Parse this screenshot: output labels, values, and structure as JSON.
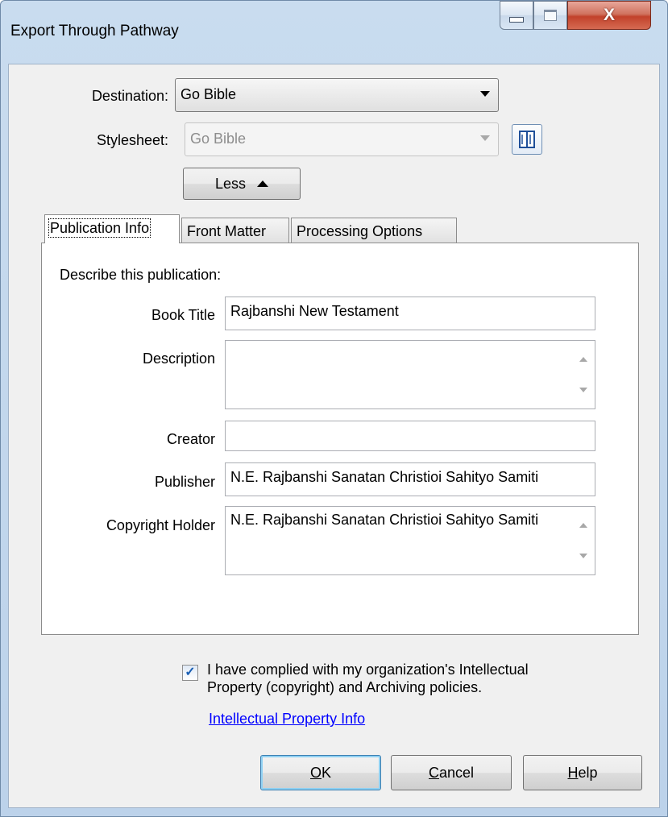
{
  "window": {
    "title": "Export Through Pathway",
    "controls": {
      "minimize_icon": "minimize-icon",
      "maximize_icon": "maximize-icon",
      "close_glyph": "X"
    }
  },
  "destination": {
    "label": "Destination:",
    "value": "Go Bible"
  },
  "stylesheet": {
    "label": "Stylesheet:",
    "value": "Go Bible",
    "enabled": false,
    "edit_icon": "book-icon"
  },
  "less_button": {
    "label": "Less"
  },
  "tabs": [
    {
      "label": "Publication Info",
      "active": true
    },
    {
      "label": "Front Matter",
      "active": false
    },
    {
      "label": "Processing Options",
      "active": false
    }
  ],
  "publication": {
    "heading": "Describe this publication:",
    "book_title": {
      "label": "Book Title",
      "value": "Rajbanshi New Testament"
    },
    "description": {
      "label": "Description",
      "value": ""
    },
    "creator": {
      "label": "Creator",
      "value": ""
    },
    "publisher": {
      "label": "Publisher",
      "value": "N.E. Rajbanshi Sanatan Christioi Sahityo Samiti"
    },
    "copyright_holder": {
      "label": "Copyright Holder",
      "value": "N.E. Rajbanshi Sanatan Christioi Sahityo Samiti"
    }
  },
  "compliance": {
    "checked": true,
    "text_line1": "I have complied with my organization's Intellectual",
    "text_line2": "Property (copyright) and Archiving policies.",
    "link": "Intellectual Property Info"
  },
  "buttons": {
    "ok": {
      "mnemonic": "O",
      "rest": "K"
    },
    "cancel": {
      "mnemonic": "C",
      "rest": "ancel"
    },
    "help": {
      "mnemonic": "H",
      "rest": "elp"
    }
  },
  "colors": {
    "accent": "#3c7fb1",
    "link": "#0000ff",
    "close_button": "#c2422b"
  }
}
